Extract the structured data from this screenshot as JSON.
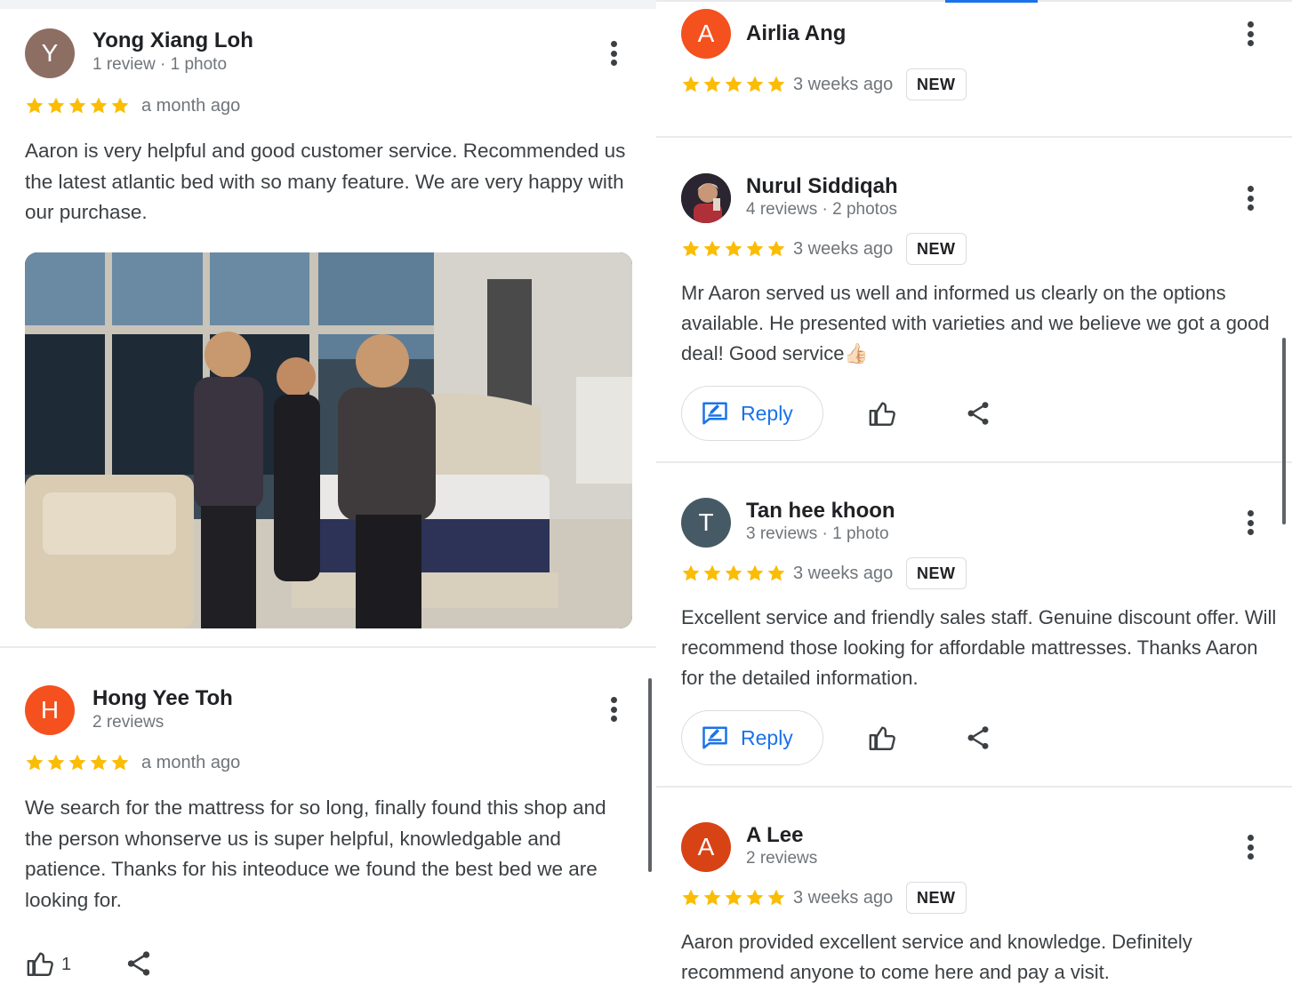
{
  "left": {
    "reviews": [
      {
        "avatar_letter": "Y",
        "avatar_color": "#8d6e63",
        "name": "Yong Xiang Loh",
        "meta": "1 review · 1 photo",
        "rating": 5,
        "when": "a month ago",
        "text": "Aaron is very helpful and good customer service. Recommended us the latest atlantic bed with so many feature. We are very happy with our purchase.",
        "photo_icon": "review-photo-people-with-bed"
      },
      {
        "avatar_letter": "H",
        "avatar_color": "#f4511e",
        "name": "Hong Yee Toh",
        "meta": "2 reviews",
        "rating": 5,
        "when": "a month ago",
        "text": "We search for the mattress for so long, finally found this shop and the person whonserve us is super helpful, knowledgable and patience. Thanks for his inteoduce we found the best bed we are looking for.",
        "like_count": "1"
      }
    ]
  },
  "right": {
    "reviews": [
      {
        "avatar_letter": "A",
        "avatar_color": "#f4511e",
        "name": "Airlia Ang",
        "rating": 5,
        "when": "3 weeks ago",
        "badge": "NEW"
      },
      {
        "avatar_icon": "profile-photo",
        "name": "Nurul Siddiqah",
        "meta": "4 reviews · 2 photos",
        "rating": 5,
        "when": "3 weeks ago",
        "badge": "NEW",
        "text": "Mr Aaron served us well and informed us clearly on the options available. He presented with varieties and we believe we got a good deal! Good service👍🏻",
        "reply_label": "Reply"
      },
      {
        "avatar_letter": "T",
        "avatar_color": "#455a64",
        "name": "Tan hee khoon",
        "meta": "3 reviews · 1 photo",
        "rating": 5,
        "when": "3 weeks ago",
        "badge": "NEW",
        "text": "Excellent service and friendly sales staff. Genuine discount offer. Will recommend those looking for affordable mattresses. Thanks Aaron for the detailed information.",
        "reply_label": "Reply"
      },
      {
        "avatar_letter": "A",
        "avatar_color": "#d84315",
        "name": "A Lee",
        "meta": "2 reviews",
        "rating": 5,
        "when": "3 weeks ago",
        "badge": "NEW",
        "text": "Aaron provided excellent service and knowledge. Definitely recommend anyone to come here and pay a visit."
      }
    ]
  },
  "colors": {
    "star": "#fbbc04",
    "accent": "#1a73e8",
    "divider": "#e8eaed",
    "icon": "#3c4043"
  }
}
